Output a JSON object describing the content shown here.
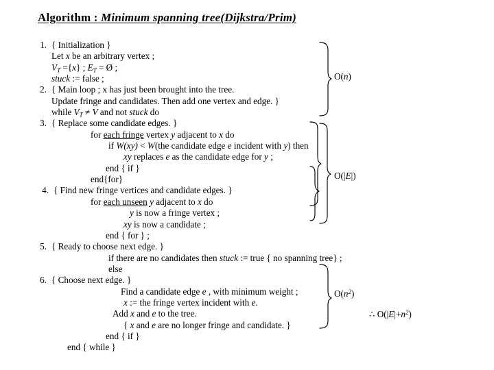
{
  "title": {
    "plain": "Algorithm : ",
    "emphasis": "Minimum spanning tree(Dijkstra/Prim)"
  },
  "algorithm": {
    "step1": {
      "number": "1.",
      "line1": "{ Initialization }",
      "line2_a": "Let ",
      "line2_x": "x",
      "line2_b": " be an arbitrary vertex ;",
      "line3_V": "V",
      "line3_Vsub": "T",
      "line3_mid": " ={",
      "line3_x": "x",
      "line3_mid2": "} ;  ",
      "line3_E": "E",
      "line3_Esub": "T",
      "line3_end": " = Ø ;",
      "line4_stuck": "stuck",
      "line4_rest": " := false ;"
    },
    "step2": {
      "number": "2.",
      "line1": "{ Main loop ; x has just been brought into the tree.",
      "line2": "Update fringe and candidates. Then add one vertex and edge. }",
      "line3_a": "while ",
      "line3_V": "V",
      "line3_Vsub": "T",
      "line3_b": " ≠ ",
      "line3_V2": "V",
      "line3_c": " and not ",
      "line3_stuck": "stuck",
      "line3_d": " do"
    },
    "step3": {
      "number": "3.",
      "line1": "{ Replace some candidate edges. }",
      "line2_a": "for ",
      "line2_ul": "each fringe",
      "line2_b": " vertex ",
      "line2_y": "y",
      "line2_c": " adjacent to ",
      "line2_x": "x",
      "line2_d": " do",
      "line3_a": "if ",
      "line3_W1": "W(xy)",
      "line3_b": " < ",
      "line3_W2": "W",
      "line3_c": "(the candidate edge ",
      "line3_e": "e",
      "line3_d": " incident with ",
      "line3_y": "y",
      "line3_f": ") then",
      "line4_xy": "xy",
      "line4_a": " replaces ",
      "line4_e": "e",
      "line4_b": " as the candidate edge for ",
      "line4_y": "y",
      "line4_c": " ;",
      "line5": "end { if }",
      "line6": "end{for}"
    },
    "step4": {
      "number": "4.",
      "line1": "{ Find new fringe vertices and candidate edges. }",
      "line2_a": "for ",
      "line2_ul": "each unseen",
      "line2_y": " y",
      "line2_b": " adjacent to ",
      "line2_x": "x",
      "line2_c": " do",
      "line3_y": "y",
      "line3_a": " is now a fringe vertex ;",
      "line4_xy": "xy",
      "line4_a": " is now a candidate ;",
      "line5": "end { for } ;"
    },
    "step5": {
      "number": "5.",
      "line1": "{ Ready to choose next edge. }",
      "line2_a": "if there are no candidates then ",
      "line2_stuck": "stuck",
      "line2_b": " := true { no spanning tree} ;",
      "line3": "else"
    },
    "step6": {
      "number": "6.",
      "line1": "{ Choose next edge. }",
      "line2_a": "Find a candidate edge ",
      "line2_e": "e",
      "line2_b": " , with minimum weight ;",
      "line3_x": "x",
      "line3_a": " := the fringe vertex incident with ",
      "line3_e": "e",
      "line3_b": ".",
      "line4_a": "Add ",
      "line4_x": "x",
      "line4_b": " and ",
      "line4_e": "e",
      "line4_c": " to the tree.",
      "line5_a": "{ ",
      "line5_x": "x",
      "line5_b": " and ",
      "line5_e": "e",
      "line5_c": " are no longer fringe and candidate. }",
      "line6": "end { if }"
    },
    "end_while": "end { while }"
  },
  "complexity": {
    "braces": [
      {
        "id": "brace-on",
        "label_O": "O(",
        "label_arg": "n",
        "label_close": ")"
      },
      {
        "id": "brace-oe",
        "label_O": "O(|",
        "label_arg": "E",
        "label_close": "|)"
      },
      {
        "id": "brace-on2",
        "label_O": "O(",
        "label_arg": "n",
        "label_sup": "2",
        "label_close": ")"
      }
    ],
    "bigO_n": {
      "pre": "O(",
      "arg": "n",
      "post": ")"
    },
    "bigO_E": {
      "pre": "O(|",
      "arg": "E",
      "post": "|)"
    },
    "bigO_n2": {
      "pre": "O(",
      "arg": "n",
      "sup": "2",
      "post": ")"
    },
    "total": {
      "therefore": "∴ ",
      "pre": "O(|",
      "argE": "E",
      "mid": "|+",
      "argN": "n",
      "sup": "2",
      "post": ")"
    }
  },
  "colors": {
    "background": "#ffffff",
    "ink": "#000000"
  }
}
